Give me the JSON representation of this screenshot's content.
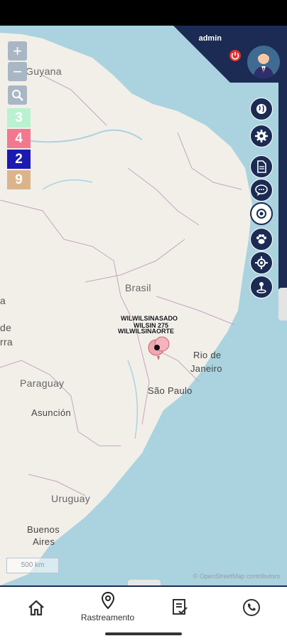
{
  "user": {
    "name": "admin"
  },
  "map": {
    "labels": {
      "guyana": "Guyana",
      "brasil": "Brasil",
      "rio": "Rio de",
      "rio2": "Janeiro",
      "saopaulo": "São Paulo",
      "paraguay": "Paraguay",
      "asuncion": "Asunción",
      "uruguay": "Uruguay",
      "ba": "Buenos",
      "ba2": "Aires",
      "edge_a": "a",
      "edge_de": "de",
      "edge_rra": "rra"
    },
    "scale": "500 km",
    "attribution": "© OpenStreetMap contributors",
    "markers": [
      "WILWILSINASADO",
      "WILSIN 275",
      "WILWILSINAORTE"
    ]
  },
  "controls": {
    "zoom_in": "+",
    "zoom_out": "−"
  },
  "counters": [
    {
      "value": "3",
      "color": "#b9f2d0"
    },
    {
      "value": "4",
      "color": "#f2788e"
    },
    {
      "value": "2",
      "color": "#1c1ab0"
    },
    {
      "value": "9",
      "color": "#dcb48c"
    }
  ],
  "toolbar_icons": [
    "globe-icon",
    "gear-icon",
    "document-icon",
    "chat-icon",
    "target-icon",
    "paw-icon",
    "crosshair-icon",
    "location-pin-icon"
  ],
  "nav": {
    "items": [
      {
        "icon": "home-icon",
        "label": ""
      },
      {
        "icon": "map-pin-icon",
        "label": "Rastreamento"
      },
      {
        "icon": "checklist-icon",
        "label": ""
      },
      {
        "icon": "phone-icon",
        "label": ""
      }
    ]
  },
  "colors": {
    "primary": "#1b2b53",
    "water": "#aad3df",
    "land": "#f2efe9"
  }
}
